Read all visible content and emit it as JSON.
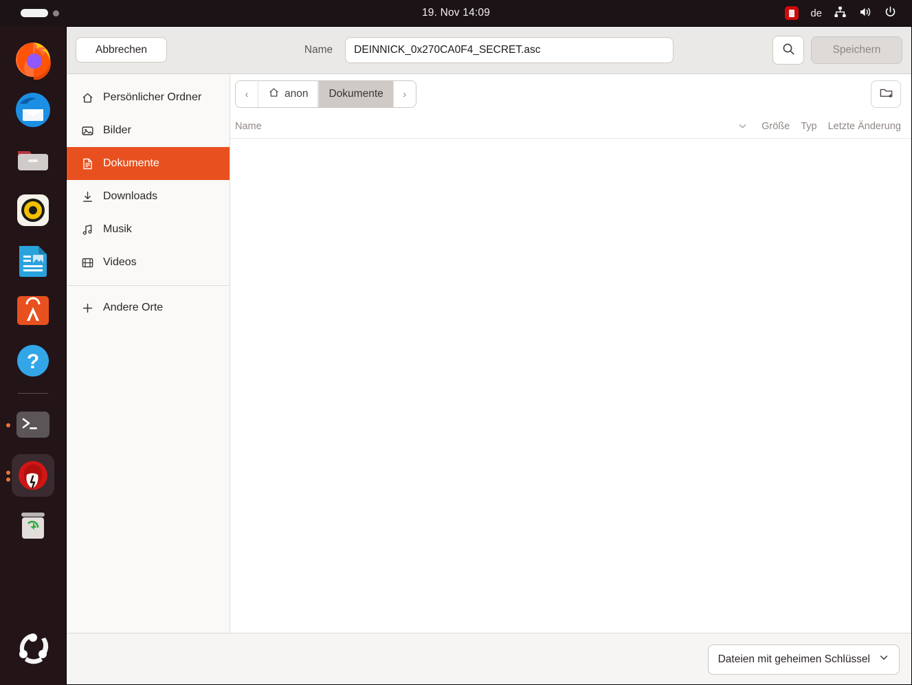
{
  "topbar": {
    "clock": "19. Nov  14:09",
    "keyboard_language": "de",
    "indicators": [
      "key-app-indicator",
      "network-icon",
      "volume-icon",
      "power-icon"
    ],
    "activity_indicator": "workspace-pill"
  },
  "dock": {
    "items": [
      {
        "name": "firefox",
        "label": "Firefox",
        "running": false
      },
      {
        "name": "thunderbird",
        "label": "Thunderbird",
        "running": false
      },
      {
        "name": "files",
        "label": "Dateien",
        "running": false
      },
      {
        "name": "rhythmbox",
        "label": "Rhythmbox",
        "running": false
      },
      {
        "name": "libreoffice-writer",
        "label": "LibreOffice Writer",
        "running": false
      },
      {
        "name": "ubuntu-software",
        "label": "Ubuntu Software",
        "running": false
      },
      {
        "name": "help",
        "label": "Hilfe",
        "running": false
      },
      {
        "name": "terminal",
        "label": "Terminal",
        "running": true
      },
      {
        "name": "seahorse",
        "label": "Passwörter und Schlüssel",
        "running": true,
        "focused": true
      },
      {
        "name": "trash",
        "label": "Papierkorb",
        "running": false
      }
    ],
    "show_apps_label": "Anwendungen anzeigen"
  },
  "dialog": {
    "cancel_label": "Abbrechen",
    "save_label": "Speichern",
    "name_label": "Name",
    "filename_value": "DEINNICK_0x270CA0F4_SECRET.asc",
    "filename_placeholder": "Name",
    "search_icon": "search-icon",
    "new_folder_icon": "new-folder-icon"
  },
  "sidebar": {
    "items": [
      {
        "label": "Persönlicher Ordner",
        "icon": "home-icon",
        "selected": false
      },
      {
        "label": "Bilder",
        "icon": "image-icon",
        "selected": false
      },
      {
        "label": "Dokumente",
        "icon": "document-icon",
        "selected": true
      },
      {
        "label": "Downloads",
        "icon": "download-icon",
        "selected": false
      },
      {
        "label": "Musik",
        "icon": "music-icon",
        "selected": false
      },
      {
        "label": "Videos",
        "icon": "video-icon",
        "selected": false
      }
    ],
    "other_locations": {
      "label": "Andere Orte",
      "icon": "plus-icon"
    }
  },
  "pathbar": {
    "back_label": "‹",
    "forward_label": "›",
    "crumbs": [
      {
        "label": "anon",
        "icon": "home-icon",
        "active": false
      },
      {
        "label": "Dokumente",
        "icon": "",
        "active": true
      }
    ]
  },
  "columns": {
    "name": "Name",
    "size": "Größe",
    "type": "Typ",
    "modified": "Letzte Änderung",
    "sort_icon": "chevron-down-icon"
  },
  "file_list": {
    "rows": [],
    "empty": true
  },
  "footer": {
    "filter_label": "Dateien mit geheimen Schlüssel",
    "filter_icon": "chevron-down-icon",
    "filter_options": [
      "Dateien mit geheimen Schlüssel"
    ]
  },
  "colors": {
    "accent": "#e8511f",
    "topbar_bg": "#1b1316",
    "dock_bg": "#241519",
    "header_bg": "#ebe9e7",
    "sidebar_bg": "#faf9f8",
    "footer_bg": "#f7f5f4"
  }
}
